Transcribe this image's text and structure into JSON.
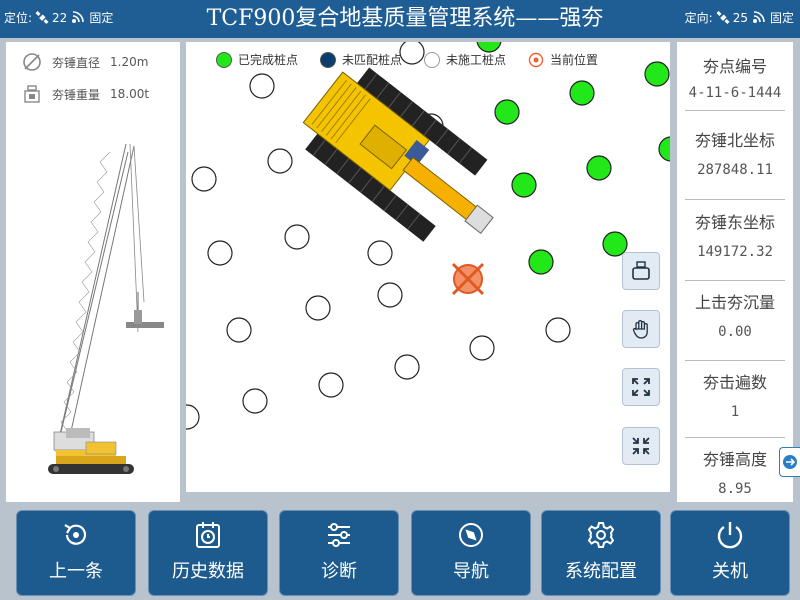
{
  "header": {
    "title": "TCF900复合地基质量管理系统——强夯",
    "left_status": {
      "label": "定位:",
      "satellites": "22",
      "mode": "固定"
    },
    "right_status": {
      "label": "定向:",
      "satellites": "25",
      "mode": "固定"
    }
  },
  "left_panel": {
    "hammer_diameter": {
      "label": "夯锤直径",
      "value": "1.20m",
      "icon": "diameter-icon"
    },
    "hammer_weight": {
      "label": "夯锤重量",
      "value": "18.00t",
      "icon": "weight-icon"
    },
    "machine_icon": "crawler-crane-illustration"
  },
  "legend": [
    {
      "label": "已完成桩点",
      "color": "#22e81a"
    },
    {
      "label": "未匹配桩点",
      "color": "#0d3d6d"
    },
    {
      "label": "未施工桩点",
      "color": "#ffffff"
    },
    {
      "label": "当前位置",
      "color": "#f06030"
    }
  ],
  "map_tools": [
    "hammer-icon",
    "hand-pan-icon",
    "expand-icon",
    "shrink-icon"
  ],
  "info": [
    {
      "label": "夯点编号",
      "value": "4-11-6-1444"
    },
    {
      "label": "夯锤北坐标",
      "value": "287848.11"
    },
    {
      "label": "夯锤东坐标",
      "value": "149172.32"
    },
    {
      "label": "上击夯沉量",
      "value": "0.00"
    },
    {
      "label": "夯击遍数",
      "value": "1"
    },
    {
      "label": "夯锤高度",
      "value": "8.95"
    }
  ],
  "toolbar": {
    "prev": "上一条",
    "history": "历史数据",
    "diagnose": "诊断",
    "navigate": "导航",
    "config": "系统配置",
    "shutdown": "关机"
  },
  "colors": {
    "header_bg": "#1e5e95",
    "button_bg": "#1d5a8d",
    "completed_pile": "#22e81a",
    "unmatched_pile": "#0d3d6d",
    "pending_pile": "#ffffff",
    "current_position": "#f06030",
    "excavator": "#f5c400"
  }
}
